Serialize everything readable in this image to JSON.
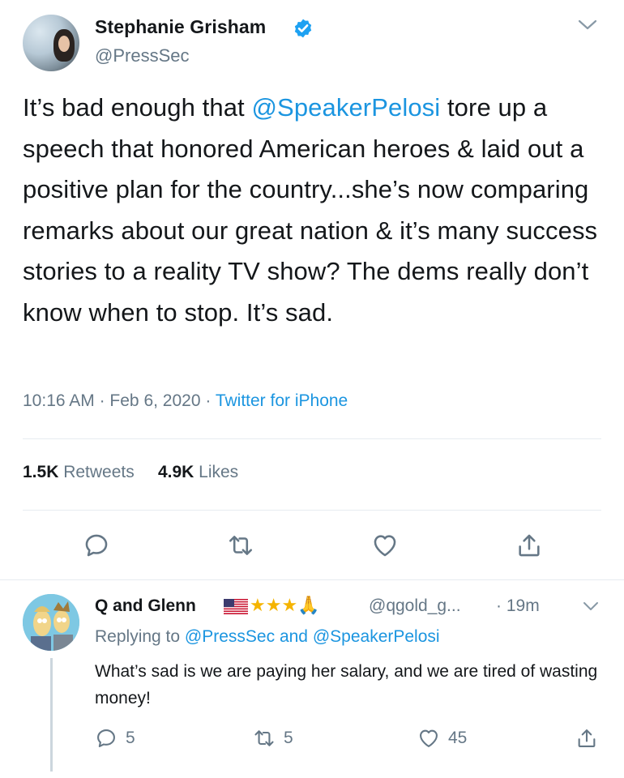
{
  "tweet": {
    "author_name": "Stephanie Grisham",
    "author_handle": "@PressSec",
    "text_before_mention": "It’s bad enough that ",
    "mention": "@SpeakerPelosi",
    "text_after_mention": " tore up a speech that honored American heroes & laid out a positive plan for the country...she’s now comparing remarks about our great nation & it’s many success stories to a reality TV show? The dems really don’t know when to stop. It’s sad.",
    "time": "10:16 AM",
    "separator": "·",
    "date": "Feb 6, 2020",
    "app": "Twitter for iPhone",
    "retweets_count": "1.5K",
    "retweets_label": "Retweets",
    "likes_count": "4.9K",
    "likes_label": "Likes",
    "icons": [
      "reply-icon",
      "retweet-icon",
      "like-icon",
      "share-icon"
    ],
    "accent_color": "#1b95e0",
    "verified_color": "#1da1f2"
  },
  "reply": {
    "author_name": "Q and Glenn",
    "author_handle": "@qgold_g...",
    "separator": "·",
    "time": "19m",
    "replying_prefix": "Replying to",
    "replying_to_1": "@PressSec",
    "replying_and": "and",
    "replying_to_2": "@SpeakerPelosi",
    "text": "What’s sad is we are paying her salary,  and we are tired of wasting money!",
    "reply_count": "5",
    "retweet_count": "5",
    "like_count": "45",
    "name_decor": "★★★🙏"
  }
}
